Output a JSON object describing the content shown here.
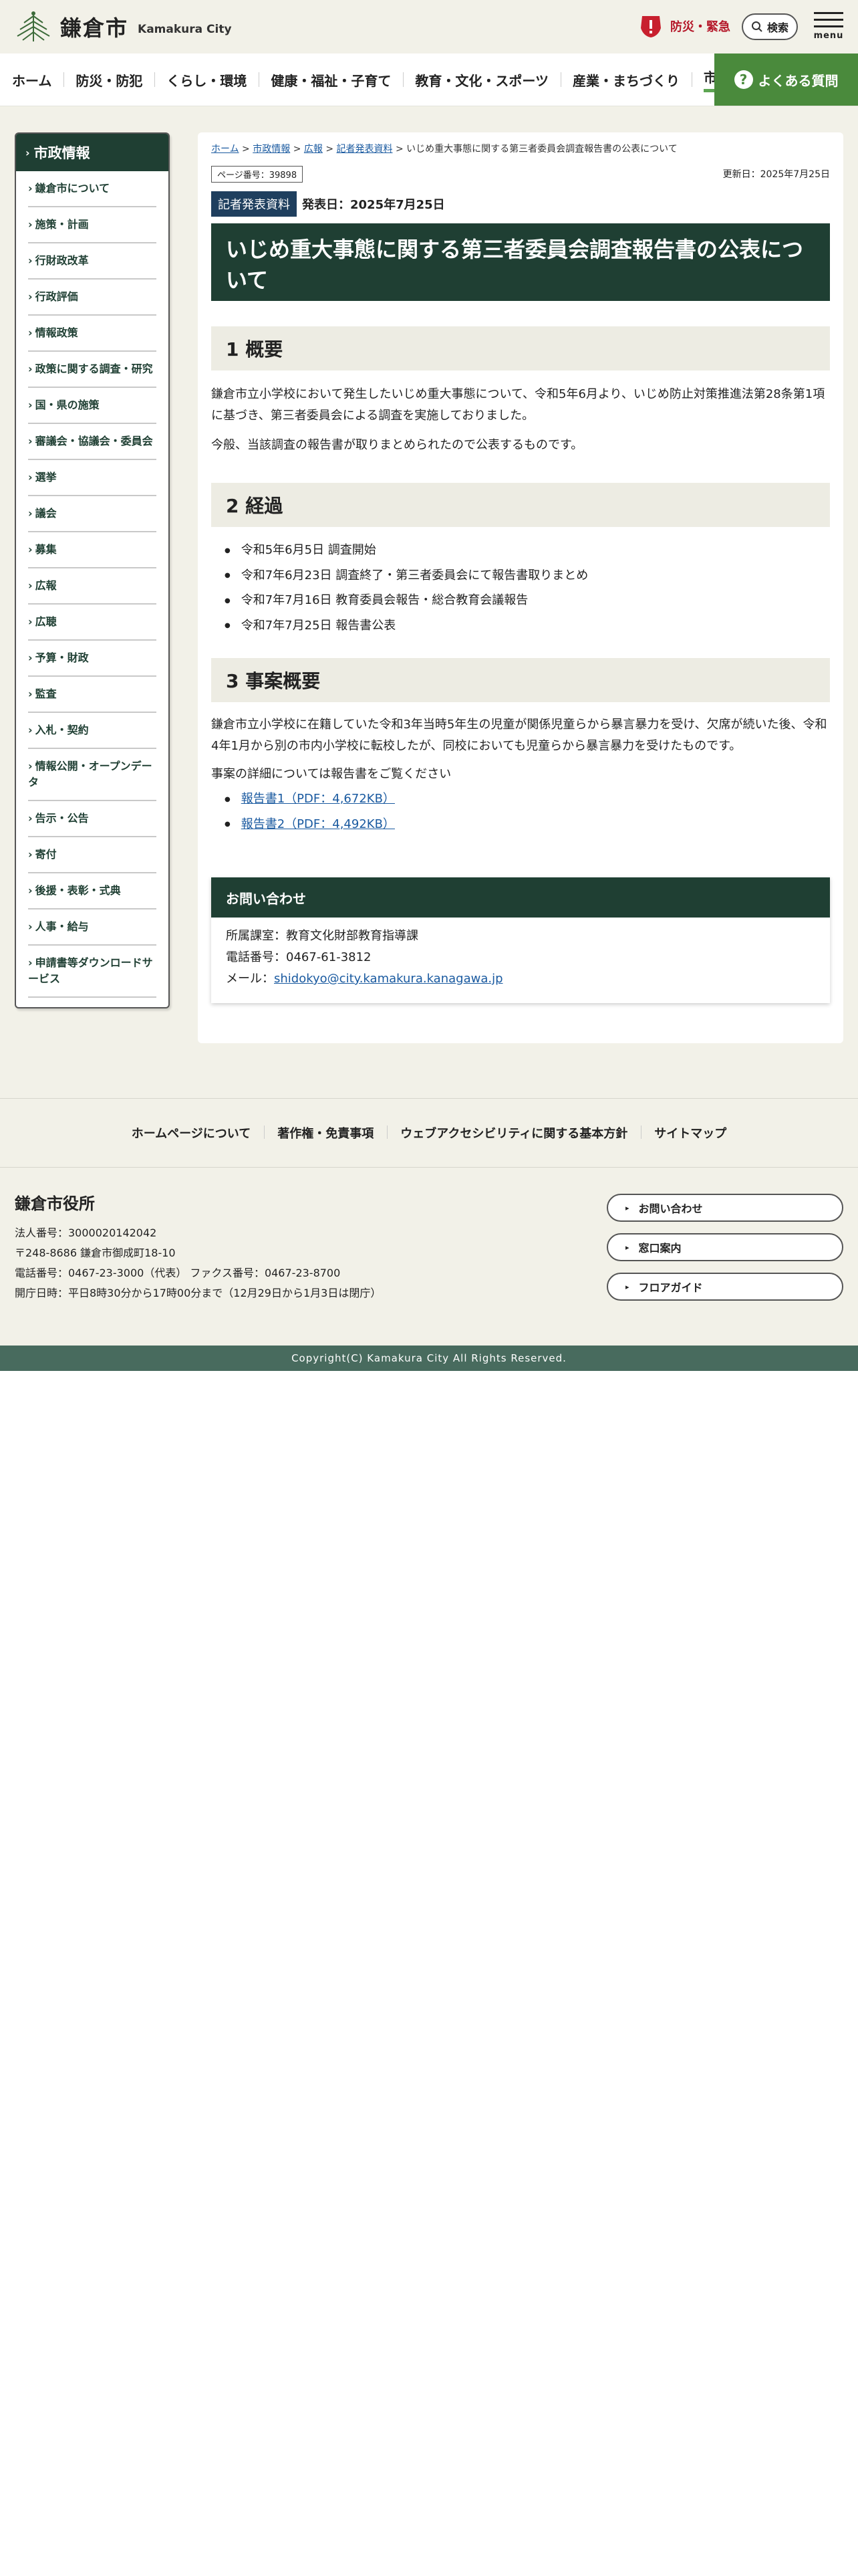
{
  "header": {
    "logo_jp": "鎌倉市",
    "logo_en": "Kamakura City",
    "emergency_label": "防災・緊急",
    "search_label": "検索",
    "menu_label": "menu"
  },
  "nav": {
    "items": [
      "ホーム",
      "防災・防犯",
      "くらし・環境",
      "健康・福祉・子育て",
      "教育・文化・スポーツ",
      "産業・まちづくり",
      "市政情報"
    ],
    "faq_label": "よくある質問"
  },
  "sidebar": {
    "title": "市政情報",
    "items": [
      "鎌倉市について",
      "施策・計画",
      "行財政改革",
      "行政評価",
      "情報政策",
      "政策に関する調査・研究",
      "国・県の施策",
      "審議会・協議会・委員会",
      "選挙",
      "議会",
      "募集",
      "広報",
      "広聴",
      "予算・財政",
      "監査",
      "入札・契約",
      "情報公開・オープンデータ",
      "告示・公告",
      "寄付",
      "後援・表彰・式典",
      "人事・給与",
      "申請書等ダウンロードサービス"
    ]
  },
  "breadcrumb": {
    "home": "ホーム",
    "level1": "市政情報",
    "level2": "広報",
    "level3": "記者発表資料",
    "current": "いじめ重大事態に関する第三者委員会調査報告書の公表について",
    "sep": ">"
  },
  "meta": {
    "page_number": "ページ番号：39898",
    "updated": "更新日：2025年7月25日",
    "press_tag": "記者発表資料",
    "press_date": "発表日：2025年7月25日"
  },
  "article": {
    "title": "いじめ重大事態に関する第三者委員会調査報告書の公表について",
    "sec1_title": "1 概要",
    "sec1_p1": "鎌倉市立小学校において発生したいじめ重大事態について、令和5年6月より、いじめ防止対策推進法第28条第1項に基づき、第三者委員会による調査を実施しておりました。",
    "sec1_p2": "今般、当該調査の報告書が取りまとめられたので公表するものです。",
    "sec2_title": "2 経過",
    "sec2_items": [
      "令和5年6月5日 調査開始",
      "令和7年6月23日 調査終了・第三者委員会にて報告書取りまとめ",
      "令和7年7月16日 教育委員会報告・総合教育会議報告",
      "令和7年7月25日 報告書公表"
    ],
    "sec3_title": "3 事案概要",
    "sec3_p1": "鎌倉市立小学校に在籍していた令和3年当時5年生の児童が関係児童らから暴言暴力を受け、欠席が続いた後、令和4年1月から別の市内小学校に転校したが、同校においても児童らから暴言暴力を受けたものです。",
    "sec3_p2": "事案の詳細については報告書をご覧ください",
    "reports": [
      "報告書1（PDF：4,672KB）",
      "報告書2（PDF：4,492KB）"
    ]
  },
  "contact": {
    "title": "お問い合わせ",
    "dept": "所属課室：教育文化財部教育指導課",
    "tel": "電話番号：0467-61-3812",
    "mail_label": "メール：",
    "mail": "shidokyo@city.kamakura.kanagawa.jp"
  },
  "footer": {
    "links": [
      "ホームページについて",
      "著作権・免責事項",
      "ウェブアクセシビリティに関する基本方針",
      "サイトマップ"
    ],
    "org_name": "鎌倉市役所",
    "corp_no": "法人番号：3000020142042",
    "address": "〒248-8686 鎌倉市御成町18-10",
    "phone": "電話番号：0467-23-3000（代表） ファクス番号：0467-23-8700",
    "hours": "開庁日時：平日8時30分から17時00分まで（12月29日から1月3日は閉庁）",
    "buttons": [
      "お問い合わせ",
      "窓口案内",
      "フロアガイド"
    ],
    "copyright": "Copyright(C) Kamakura City All Rights Reserved."
  },
  "colors": {
    "dark_green": "#1f3f33",
    "faq_green": "#4a8a3c",
    "emergency_red": "#b5182a",
    "link_blue": "#1a5aa0"
  }
}
